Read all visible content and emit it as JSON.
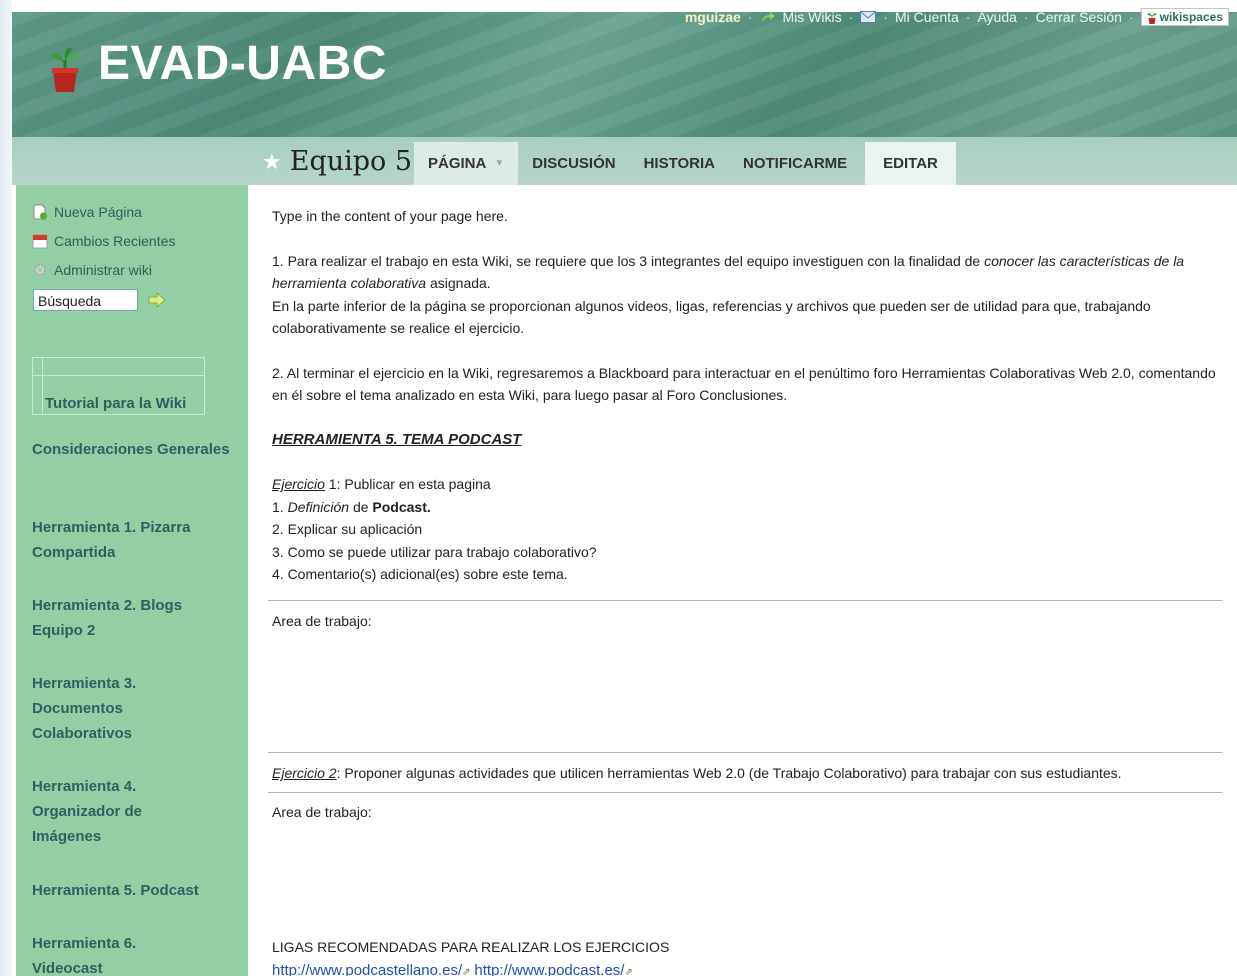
{
  "site": {
    "title": "EVAD-UABC"
  },
  "userbar": {
    "username": "mguizae",
    "my_wikis": "Mis Wikis",
    "account": "Mi Cuenta",
    "help": "Ayuda",
    "logout": "Cerrar Sesión",
    "brand": "wikispaces"
  },
  "page": {
    "title": "Equipo 5"
  },
  "tabs": {
    "page": "PÁGINA",
    "discussion": "DISCUSIÓN",
    "history": "HISTORIA",
    "notify": "NOTIFICARME",
    "edit": "EDITAR"
  },
  "sidebar": {
    "new_page": "Nueva Página",
    "recent_changes": "Cambios Recientes",
    "manage_wiki": "Administrar wiki",
    "search_value": "Búsqueda",
    "tutorial": "Tutorial para la Wiki",
    "nav": [
      "Consideraciones Generales",
      "Herramienta 1. Pizarra Compartida",
      "Herramienta 2. Blogs Equipo 2",
      "Herramienta 3. Documentos Colaborativos",
      "Herramienta 4. Organizador de Imágenes",
      "Herramienta 5. Podcast",
      "Herramienta 6. Videocast"
    ]
  },
  "content": {
    "intro": "Type in the content of your page here.",
    "p1_a": "1. Para realizar el trabajo en esta Wiki, se requiere que los 3 integrantes del equipo investiguen con la finalidad de ",
    "p1_i": "conocer las características de la herramienta colaborativa",
    "p1_b": " asignada.",
    "p1_c": "En la parte inferior de la página se proporcionan algunos videos, ligas, referencias y archivos que pueden ser de utilidad para que, trabajando colaborativamente se realice el ejercicio.",
    "p2": "2. Al terminar el ejercicio en la Wiki, regresaremos a Blackboard para interactuar en el penúltimo foro Herramientas Colaborativas Web 2.0, comentando en él sobre el tema analizado en esta Wiki, para luego pasar al Foro Conclusiones.",
    "heading": "HERRAMIENTA 5. TEMA PODCAST",
    "ex1_label": "Ejercicio",
    "ex1_rest": " 1: Publicar en esta pagina",
    "ex1_item1_a": "1. ",
    "ex1_item1_i": "Definición",
    "ex1_item1_b": " de ",
    "ex1_item1_bold": "Podcast.",
    "ex1_item2": "2. Explicar su aplicación",
    "ex1_item3": "3. Como se puede utilizar para trabajo colaborativo?",
    "ex1_item4": "4. Comentario(s) adicional(es) sobre este tema.",
    "work_area": "Area de trabajo:",
    "ex2_label": "Ejercicio 2",
    "ex2_rest": ": Proponer algunas actividades que utilicen herramientas Web 2.0 (de Trabajo Colaborativo) para trabajar con sus estudiantes.",
    "work_area2": "Area de trabajo:",
    "links_heading": "LIGAS RECOMENDADAS PARA REALIZAR LOS EJERCICIOS",
    "link1": "http://www.podcastellano.es/",
    "link2": "http://www.podcast.es/"
  }
}
